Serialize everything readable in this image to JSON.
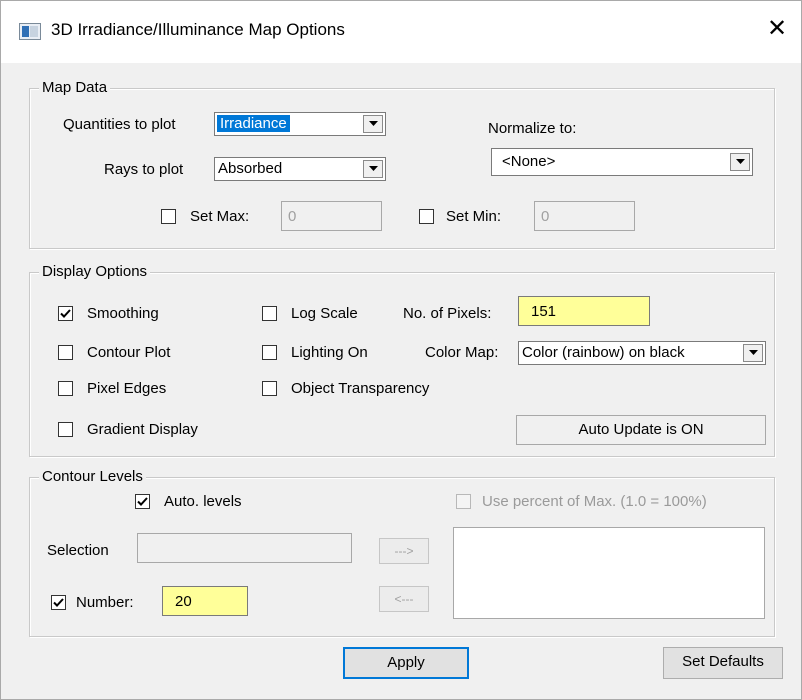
{
  "window": {
    "title": "3D Irradiance/Illuminance Map Options"
  },
  "map_data": {
    "legend": "Map Data",
    "quantities_label": "Quantities to plot",
    "quantities_value": "Irradiance",
    "rays_label": "Rays to plot",
    "rays_value": "Absorbed",
    "normalize_label": "Normalize to:",
    "normalize_value": "<None>",
    "set_max_label": "Set Max:",
    "set_max_checked": false,
    "set_max_value": "0",
    "set_min_label": "Set Min:",
    "set_min_checked": false,
    "set_min_value": "0"
  },
  "display_options": {
    "legend": "Display Options",
    "smoothing_label": "Smoothing",
    "smoothing_checked": true,
    "contour_plot_label": "Contour Plot",
    "contour_plot_checked": false,
    "pixel_edges_label": "Pixel Edges",
    "pixel_edges_checked": false,
    "gradient_display_label": "Gradient Display",
    "gradient_display_checked": false,
    "log_scale_label": "Log Scale",
    "log_scale_checked": false,
    "lighting_on_label": "Lighting On",
    "lighting_on_checked": false,
    "object_transparency_label": "Object Transparency",
    "object_transparency_checked": false,
    "pixels_label": "No. of Pixels:",
    "pixels_value": "151",
    "color_map_label": "Color Map:",
    "color_map_value": "Color (rainbow) on black",
    "auto_update_status": "Auto Update is ON"
  },
  "contour_levels": {
    "legend": "Contour Levels",
    "auto_levels_label": "Auto. levels",
    "auto_levels_checked": true,
    "use_percent_label": "Use percent of Max. (1.0 = 100%)",
    "use_percent_checked": false,
    "selection_label": "Selection",
    "selection_value": "",
    "add_button": "--->",
    "remove_button": "<---",
    "number_label": "Number:",
    "number_checked": true,
    "number_value": "20"
  },
  "footer": {
    "apply_button": "Apply",
    "set_defaults_button": "Set Defaults"
  },
  "colors": {
    "highlight": "#0078d7",
    "field_yellow": "#ffff99",
    "background": "#f0f0f0"
  }
}
